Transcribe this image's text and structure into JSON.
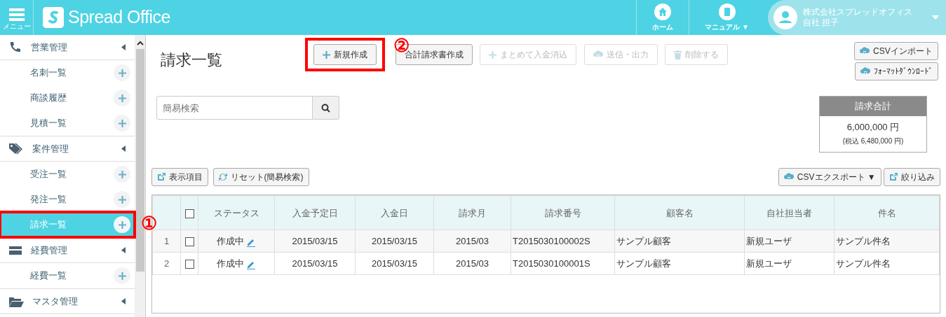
{
  "header": {
    "menu_label": "メニュー",
    "logo_text": "Spread Office",
    "nav": [
      {
        "kind": "home",
        "label": "ホーム"
      },
      {
        "kind": "manual",
        "label": "マニュアル ▼"
      }
    ],
    "user": {
      "company": "株式会社スプレッドオフィス",
      "name": "自社 担子"
    }
  },
  "sidebar": {
    "groups": [
      {
        "kind": "phone",
        "label": "営業管理",
        "children": [
          {
            "label": "名刺一覧",
            "selected": false
          },
          {
            "label": "商談履歴",
            "selected": false
          },
          {
            "label": "見積一覧",
            "selected": false
          }
        ]
      },
      {
        "kind": "tag",
        "label": "案件管理",
        "children": [
          {
            "label": "受注一覧",
            "selected": false
          },
          {
            "label": "発注一覧",
            "selected": false
          },
          {
            "label": "請求一覧",
            "selected": true,
            "highlighted": true,
            "callout": "①"
          }
        ]
      },
      {
        "kind": "card",
        "label": "経費管理",
        "children": [
          {
            "label": "経費一覧",
            "selected": false
          }
        ]
      },
      {
        "kind": "folder",
        "label": "マスタ管理"
      }
    ]
  },
  "page": {
    "title": "請求一覧",
    "toolbar": [
      {
        "label": "新規作成",
        "kind": "plus",
        "disabled": false,
        "highlighted": true,
        "callout": "②"
      },
      {
        "label": "合計請求書作成",
        "disabled": false
      },
      {
        "label": "まとめて入金消込",
        "kind": "plus",
        "disabled": true
      },
      {
        "label": "送信・出力",
        "kind": "cloud",
        "disabled": true
      },
      {
        "label": "削除する",
        "kind": "trash",
        "disabled": true
      }
    ],
    "side_buttons": [
      {
        "label": "CSVインポート",
        "kind": "cloud"
      },
      {
        "label": "ﾌｫｰﾏｯﾄﾀﾞｳﾝﾛｰﾄﾞ",
        "kind": "cloud"
      }
    ],
    "search": {
      "placeholder": "簡易検索"
    },
    "total": {
      "title": "請求合計",
      "amount": "6,000,000 円",
      "tax": "(税込 6,480,000 円)"
    },
    "list_tools": [
      {
        "label": "表示項目",
        "kind": "external"
      },
      {
        "label": "リセット(簡易検索)",
        "kind": "refresh"
      }
    ],
    "list_tools_right": [
      {
        "label": "CSVエクスポート ▼",
        "kind": "cloud"
      },
      {
        "label": "絞り込み",
        "kind": "external"
      }
    ],
    "table": {
      "all_checked": false,
      "columns": [
        "ステータス",
        "入金予定日",
        "入金日",
        "請求月",
        "請求番号",
        "顧客名",
        "自社担当者",
        "件名"
      ],
      "rows": [
        {
          "number": "1",
          "checked": false,
          "cells": [
            "作成中",
            "2015/03/15",
            "2015/03/15",
            "2015/03",
            "T2015030100002S",
            "サンプル顧客",
            "新規ユーザ",
            "サンプル件名"
          ]
        },
        {
          "number": "2",
          "checked": false,
          "cells": [
            "作成中",
            "2015/03/15",
            "2015/03/15",
            "2015/03",
            "T2015030100001S",
            "サンプル顧客",
            "新規ユーザ",
            "サンプル件名"
          ]
        }
      ]
    }
  }
}
